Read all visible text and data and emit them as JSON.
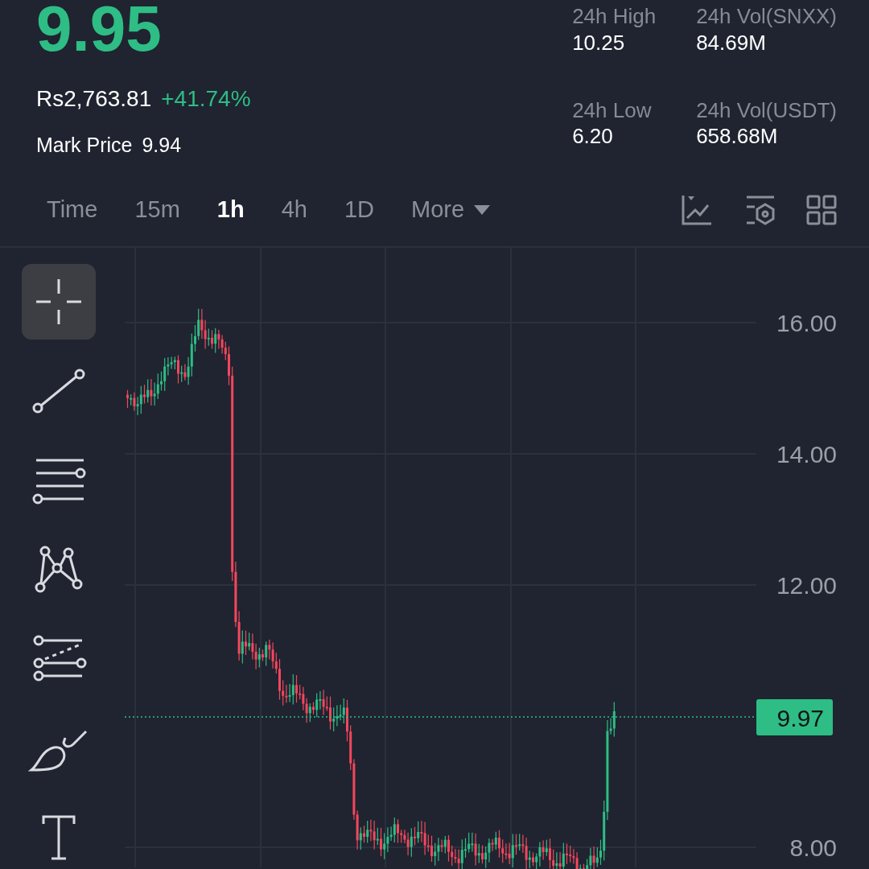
{
  "price": {
    "last": "9.95",
    "fiat": "Rs2,763.81",
    "change": "+41.74%",
    "mark_label": "Mark Price",
    "mark_value": "9.94"
  },
  "stats": [
    {
      "label": "24h High",
      "value": "10.25"
    },
    {
      "label": "24h Vol(SNXX)",
      "value": "84.69M"
    },
    {
      "label": "24h Low",
      "value": "6.20"
    },
    {
      "label": "24h Vol(USDT)",
      "value": "658.68M"
    }
  ],
  "intervals": [
    {
      "label": "Time",
      "selected": false,
      "kind": "tab"
    },
    {
      "label": "15m",
      "selected": false,
      "kind": "tab"
    },
    {
      "label": "1h",
      "selected": true,
      "kind": "tab"
    },
    {
      "label": "4h",
      "selected": false,
      "kind": "tab"
    },
    {
      "label": "1D",
      "selected": false,
      "kind": "tab"
    },
    {
      "label": "More",
      "selected": false,
      "kind": "dropdown"
    }
  ],
  "drawing_tools": [
    {
      "kind": "crosshair",
      "selected": true
    },
    {
      "kind": "line",
      "selected": false
    },
    {
      "kind": "hlines",
      "selected": false
    },
    {
      "kind": "pattern",
      "selected": false
    },
    {
      "kind": "fib",
      "selected": false
    },
    {
      "kind": "brush",
      "selected": false
    },
    {
      "kind": "text",
      "selected": false
    }
  ],
  "chart": {
    "price_axis": [
      "16.00",
      "14.00",
      "12.00",
      "8.00"
    ],
    "current_price": "9.97"
  }
}
